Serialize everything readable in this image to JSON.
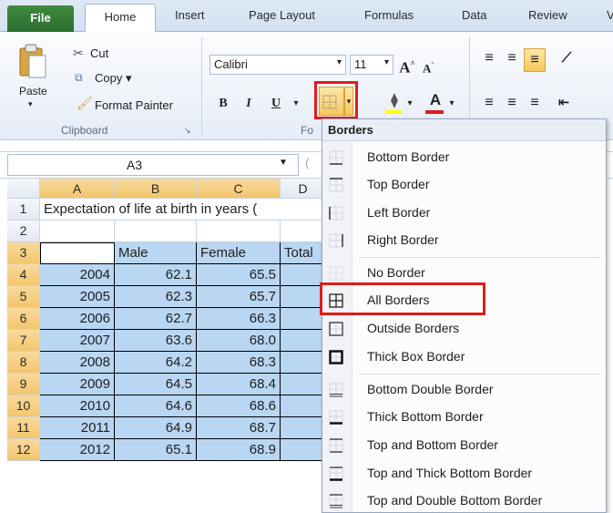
{
  "ribbon_tabs": [
    "File",
    "Home",
    "Insert",
    "Page Layout",
    "Formulas",
    "Data",
    "Review",
    "V"
  ],
  "clipboard": {
    "paste": "Paste",
    "cut": "Cut",
    "copy": "Copy ▾",
    "format_painter": "Format Painter",
    "group_title": "Clipboard"
  },
  "font": {
    "name": "Calibri",
    "size": "11",
    "group_title_partial": "Fo",
    "bold": "B",
    "italic": "I",
    "underline": "U"
  },
  "namebox": {
    "value": "A3",
    "fx_partial": "("
  },
  "columns": [
    "A",
    "B",
    "C",
    "D"
  ],
  "rows": [
    "1",
    "2",
    "3",
    "4",
    "5",
    "6",
    "7",
    "8",
    "9",
    "10",
    "11",
    "12"
  ],
  "sheet": {
    "title": "Expectation of life at birth in years (",
    "headers": [
      "",
      "Male",
      "Female",
      "Total"
    ],
    "data": [
      [
        "2004",
        "62.1",
        "65.5"
      ],
      [
        "2005",
        "62.3",
        "65.7"
      ],
      [
        "2006",
        "62.7",
        "66.3"
      ],
      [
        "2007",
        "63.6",
        "68.0"
      ],
      [
        "2008",
        "64.2",
        "68.3"
      ],
      [
        "2009",
        "64.5",
        "68.4"
      ],
      [
        "2010",
        "64.6",
        "68.6"
      ],
      [
        "2011",
        "64.9",
        "68.7"
      ],
      [
        "2012",
        "65.1",
        "68.9"
      ]
    ]
  },
  "borders_menu": {
    "title": "Borders",
    "items": [
      "Bottom Border",
      "Top Border",
      "Left Border",
      "Right Border",
      "No Border",
      "All Borders",
      "Outside Borders",
      "Thick Box Border",
      "Bottom Double Border",
      "Thick Bottom Border",
      "Top and Bottom Border",
      "Top and Thick Bottom Border",
      "Top and Double Bottom Border"
    ]
  },
  "colors": {
    "highlight": "#e01b1b",
    "selection": "#b9d6f2",
    "file_tab": "#2f7332"
  }
}
